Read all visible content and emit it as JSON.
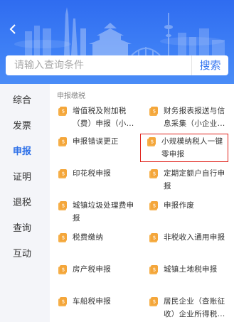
{
  "header": {
    "back_icon": "chevron-left-icon"
  },
  "search": {
    "placeholder": "请输入查询条件",
    "button_label": "搜索"
  },
  "sidebar": {
    "items": [
      {
        "label": "综合",
        "active": false
      },
      {
        "label": "发票",
        "active": false
      },
      {
        "label": "申报",
        "active": true
      },
      {
        "label": "证明",
        "active": false
      },
      {
        "label": "退税",
        "active": false
      },
      {
        "label": "查询",
        "active": false
      },
      {
        "label": "互动",
        "active": false
      }
    ]
  },
  "main": {
    "section_title": "申报缴税",
    "items": [
      {
        "label": "增值税及附加税（费）申报（小..."
      },
      {
        "label": "财务报表报送与信息采集（小企业..."
      },
      {
        "label": "申报错误更正"
      },
      {
        "label": "小规模纳税人一键零申报"
      },
      {
        "label": "印花税申报"
      },
      {
        "label": "定期定额户自行申报"
      },
      {
        "label": "城镇垃圾处理费申报"
      },
      {
        "label": "申报作废"
      },
      {
        "label": "税费缴纳"
      },
      {
        "label": "非税收入通用申报"
      },
      {
        "label": "房产税申报"
      },
      {
        "label": "城镇土地税申报"
      },
      {
        "label": "车船税申报"
      },
      {
        "label": "居民企业（查账征收）企业所得税..."
      }
    ],
    "icon_name": "tax-doc-icon"
  },
  "colors": {
    "header": "#3173f0",
    "accent": "#2c6fe8",
    "icon": "#f4a63a",
    "highlight_box": "#e0211a"
  }
}
